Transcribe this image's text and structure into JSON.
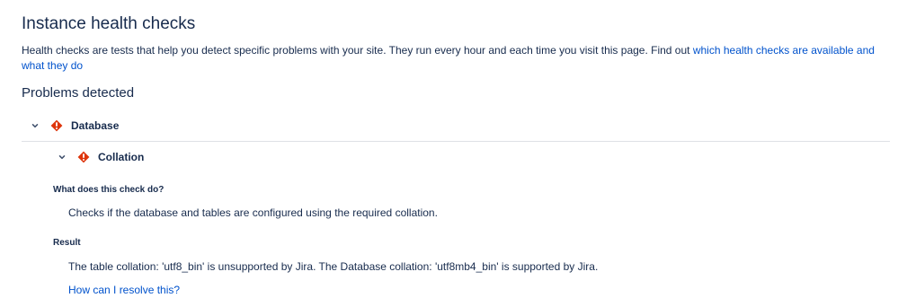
{
  "page": {
    "title": "Instance health checks",
    "intro_text": "Health checks are tests that help you detect specific problems with your site. They run every hour and each time you visit this page. Find out ",
    "intro_link": "which health checks are available and what they do",
    "problems_heading": "Problems detected"
  },
  "categories": [
    {
      "label": "Database",
      "expanded": true,
      "status": "error",
      "checks": [
        {
          "label": "Collation",
          "expanded": true,
          "status": "error",
          "what_label": "What does this check do?",
          "what_text": "Checks if the database and tables are configured using the required collation.",
          "result_label": "Result",
          "result_text": "The table collation: 'utf8_bin' is unsupported by Jira. The Database collation: 'utf8mb4_bin' is supported by Jira.",
          "resolve_link": "How can I resolve this?"
        }
      ]
    }
  ],
  "icons": {
    "expand": "chevron-down-icon",
    "error": "error-icon"
  },
  "colors": {
    "text": "#172b4d",
    "link": "#0052cc",
    "error": "#de350b",
    "divider": "#dfe1e6"
  }
}
